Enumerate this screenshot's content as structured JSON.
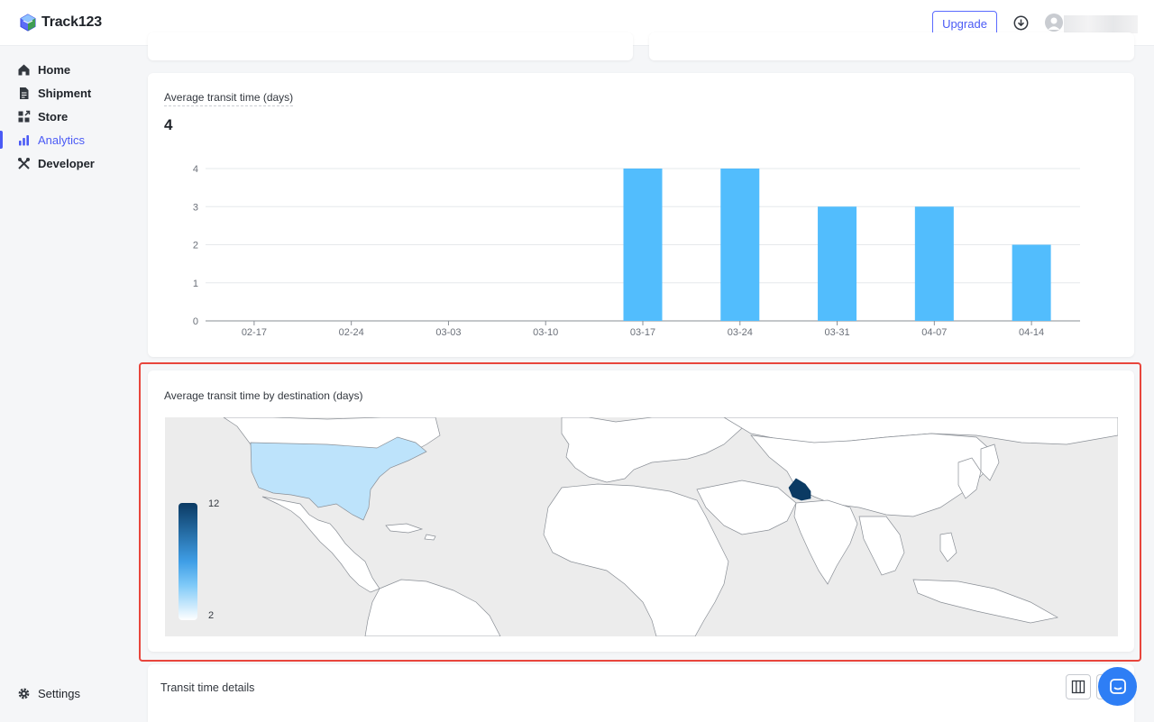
{
  "app": {
    "name": "Track123"
  },
  "topbar": {
    "upgrade_label": "Upgrade"
  },
  "sidebar": {
    "items": [
      {
        "label": "Home",
        "icon": "home-icon"
      },
      {
        "label": "Shipment",
        "icon": "document-icon"
      },
      {
        "label": "Store",
        "icon": "store-icon"
      },
      {
        "label": "Analytics",
        "icon": "bar-chart-icon",
        "active": true
      },
      {
        "label": "Developer",
        "icon": "tools-icon"
      }
    ],
    "settings_label": "Settings"
  },
  "transit_card": {
    "title": "Average transit time (days)",
    "value": "4"
  },
  "chart_data": {
    "type": "bar",
    "categories": [
      "02-17",
      "02-24",
      "03-03",
      "03-10",
      "03-17",
      "03-24",
      "03-31",
      "04-07",
      "04-14"
    ],
    "values": [
      0,
      0,
      0,
      0,
      4,
      4,
      3,
      3,
      2
    ],
    "yticks": [
      "0",
      "1",
      "2",
      "3",
      "4"
    ],
    "ylim": [
      0,
      4
    ],
    "bar_color": "#52bdfd",
    "grid": true
  },
  "map_card": {
    "title": "Average transit time by destination (days)",
    "legend_max": "12",
    "legend_min": "2",
    "colors": {
      "high": "#0b3a63",
      "low": "#ffffff",
      "usa": "#bde3fb",
      "pakistan": "#0b3a63",
      "ocean": "#ececec"
    }
  },
  "details_card": {
    "title": "Transit time details"
  },
  "colors": {
    "accent": "#4a5af5",
    "highlight": "#e8453c"
  }
}
